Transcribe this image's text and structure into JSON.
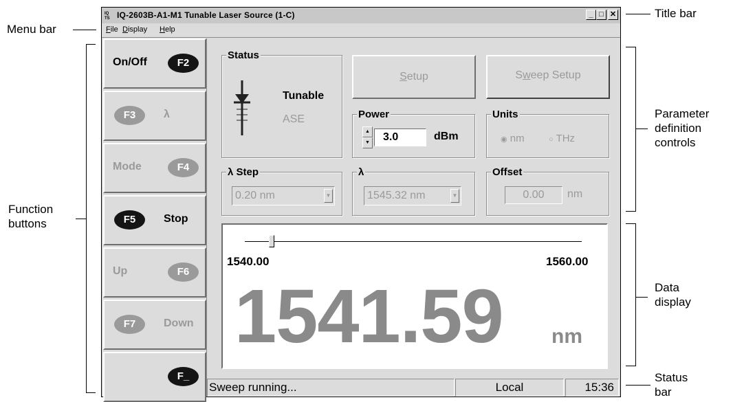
{
  "window": {
    "title": "IQ-2603B-A1-M1 Tunable Laser Source  (1-C)",
    "app_icon_text": "IQ\nT/S",
    "controls": {
      "minimize": "_",
      "maximize": "□",
      "close": "✕"
    }
  },
  "menu": {
    "items": [
      {
        "accel": "F",
        "rest": "ile"
      },
      {
        "accel": "D",
        "rest": "isplay"
      },
      {
        "accel": "H",
        "rest": "elp"
      }
    ]
  },
  "function_buttons": [
    {
      "label": "On/Off",
      "key": "F2",
      "enabled": true,
      "key_side": "right"
    },
    {
      "label": "λ",
      "key": "F3",
      "enabled": false,
      "key_side": "left"
    },
    {
      "label": "Mode",
      "key": "F4",
      "enabled": false,
      "key_side": "right"
    },
    {
      "label": "Stop",
      "key": "F5",
      "enabled": true,
      "key_side": "left"
    },
    {
      "label": "Up",
      "key": "F6",
      "enabled": false,
      "key_side": "right"
    },
    {
      "label": "Down",
      "key": "F7",
      "enabled": false,
      "key_side": "left"
    },
    {
      "label": "",
      "key": "F_",
      "enabled": true,
      "key_side": "right"
    }
  ],
  "status_group": {
    "title": "Status",
    "tunable_label": "Tunable",
    "ase_label": "ASE"
  },
  "setup_button": {
    "label": "Setup",
    "accel_index": 0
  },
  "sweep_setup_button": {
    "label": "Sweep Setup"
  },
  "power_group": {
    "title": "Power",
    "value": "3.0",
    "unit": "dBm"
  },
  "units_group": {
    "title": "Units",
    "option_nm": "nm",
    "option_thz": "THz",
    "selected": "nm"
  },
  "step_group": {
    "title": "λ Step",
    "value": "0.20 nm"
  },
  "lambda_group": {
    "title": "λ",
    "value": "1545.32 nm"
  },
  "offset_group": {
    "title": "Offset",
    "value": "0.00",
    "unit": "nm"
  },
  "display": {
    "range_min": "1540.00",
    "range_max": "1560.00",
    "slider_fraction": 0.08,
    "reading": "1541.59",
    "unit": "nm"
  },
  "status_bar": {
    "message": "Sweep running...",
    "mode": "Local",
    "time": "15:36"
  },
  "callouts": {
    "menu_bar": "Menu bar",
    "title_bar": "Title bar",
    "function_buttons_1": "Function",
    "function_buttons_2": "buttons",
    "parameter_1": "Parameter",
    "parameter_2": "definition",
    "parameter_3": "controls",
    "data_1": "Data",
    "data_2": "display",
    "status_1": "Status",
    "status_2": "bar"
  }
}
